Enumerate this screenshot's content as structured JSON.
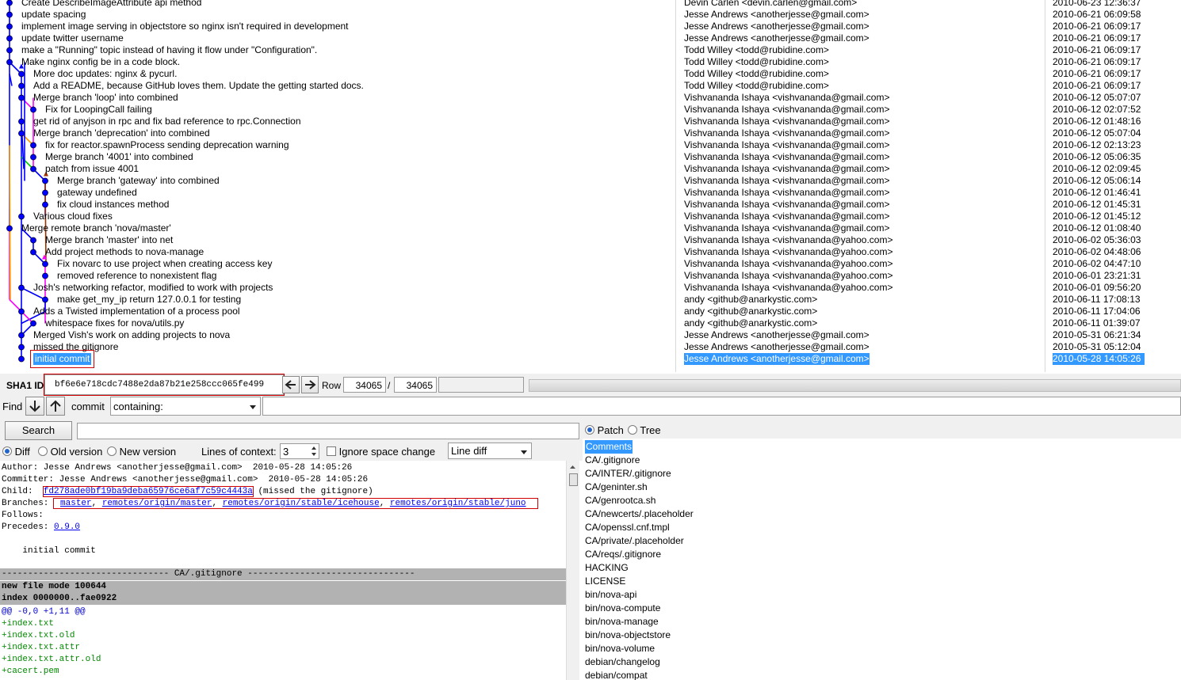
{
  "commits": [
    {
      "subject": "Create DescribeImageAttribute api method",
      "author": "Devin Carlen <devin.carlen@gmail.com>",
      "date": "2010-06-23 12:36:37"
    },
    {
      "subject": "update spacing",
      "author": "Jesse Andrews <anotherjesse@gmail.com>",
      "date": "2010-06-21 06:09:58"
    },
    {
      "subject": "implement image serving in objectstore so nginx isn't required in development",
      "author": "Jesse Andrews <anotherjesse@gmail.com>",
      "date": "2010-06-21 06:09:17"
    },
    {
      "subject": "update twitter username",
      "author": "Jesse Andrews <anotherjesse@gmail.com>",
      "date": "2010-06-21 06:09:17"
    },
    {
      "subject": "make a \"Running\" topic instead of having it flow under \"Configuration\".",
      "author": "Todd Willey <todd@rubidine.com>",
      "date": "2010-06-21 06:09:17"
    },
    {
      "subject": "Make nginx config be in a code block.",
      "author": "Todd Willey <todd@rubidine.com>",
      "date": "2010-06-21 06:09:17"
    },
    {
      "subject": "More doc updates: nginx & pycurl.",
      "author": "Todd Willey <todd@rubidine.com>",
      "date": "2010-06-21 06:09:17"
    },
    {
      "subject": "Add a README, because GitHub loves them.  Update the getting started docs.",
      "author": "Todd Willey <todd@rubidine.com>",
      "date": "2010-06-21 06:09:17"
    },
    {
      "subject": "Merge branch 'loop' into combined",
      "author": "Vishvananda Ishaya <vishvananda@gmail.com>",
      "date": "2010-06-12 05:07:07"
    },
    {
      "subject": "Fix for LoopingCall failing",
      "author": "Vishvananda Ishaya <vishvananda@gmail.com>",
      "date": "2010-06-12 02:07:52"
    },
    {
      "subject": "get rid of anyjson in rpc and fix bad reference to rpc.Connection",
      "author": "Vishvananda Ishaya <vishvananda@gmail.com>",
      "date": "2010-06-12 01:48:16"
    },
    {
      "subject": "Merge branch 'deprecation' into combined",
      "author": "Vishvananda Ishaya <vishvananda@gmail.com>",
      "date": "2010-06-12 05:07:04"
    },
    {
      "subject": "fix for reactor.spawnProcess sending deprecation warning",
      "author": "Vishvananda Ishaya <vishvananda@gmail.com>",
      "date": "2010-06-12 02:13:23"
    },
    {
      "subject": "Merge branch '4001' into combined",
      "author": "Vishvananda Ishaya <vishvananda@gmail.com>",
      "date": "2010-06-12 05:06:35"
    },
    {
      "subject": "patch from issue 4001",
      "author": "Vishvananda Ishaya <vishvananda@gmail.com>",
      "date": "2010-06-12 02:09:45"
    },
    {
      "subject": "Merge branch 'gateway' into combined",
      "author": "Vishvananda Ishaya <vishvananda@gmail.com>",
      "date": "2010-06-12 05:06:14"
    },
    {
      "subject": "gateway undefined",
      "author": "Vishvananda Ishaya <vishvananda@gmail.com>",
      "date": "2010-06-12 01:46:41"
    },
    {
      "subject": "fix cloud instances method",
      "author": "Vishvananda Ishaya <vishvananda@gmail.com>",
      "date": "2010-06-12 01:45:31"
    },
    {
      "subject": "Various cloud fixes",
      "author": "Vishvananda Ishaya <vishvananda@gmail.com>",
      "date": "2010-06-12 01:45:12"
    },
    {
      "subject": "Merge remote branch 'nova/master'",
      "author": "Vishvananda Ishaya <vishvananda@gmail.com>",
      "date": "2010-06-12 01:08:40"
    },
    {
      "subject": "Merge branch 'master' into net",
      "author": "Vishvananda Ishaya <vishvananda@yahoo.com>",
      "date": "2010-06-02 05:36:03"
    },
    {
      "subject": "Add project methods to nova-manage",
      "author": "Vishvananda Ishaya <vishvananda@yahoo.com>",
      "date": "2010-06-02 04:48:06"
    },
    {
      "subject": "Fix novarc to use project when creating access key",
      "author": "Vishvananda Ishaya <vishvananda@yahoo.com>",
      "date": "2010-06-02 04:47:10"
    },
    {
      "subject": "removed reference to nonexistent flag",
      "author": "Vishvananda Ishaya <vishvananda@yahoo.com>",
      "date": "2010-06-01 23:21:31"
    },
    {
      "subject": "Josh's networking refactor, modified to work with projects",
      "author": "Vishvananda Ishaya <vishvananda@yahoo.com>",
      "date": "2010-06-01 09:56:20"
    },
    {
      "subject": "make get_my_ip return 127.0.0.1 for testing",
      "author": "andy <github@anarkystic.com>",
      "date": "2010-06-11 17:08:13"
    },
    {
      "subject": "Adds a Twisted implementation of a process pool",
      "author": "andy <github@anarkystic.com>",
      "date": "2010-06-11 17:04:06"
    },
    {
      "subject": "whitespace fixes for nova/utils.py",
      "author": "andy <github@anarkystic.com>",
      "date": "2010-06-11 01:39:07"
    },
    {
      "subject": "Merged Vish's work on adding projects to nova",
      "author": "Jesse Andrews <anotherjesse@gmail.com>",
      "date": "2010-05-31 06:21:34"
    },
    {
      "subject": "missed the gitignore",
      "author": "Jesse Andrews <anotherjesse@gmail.com>",
      "date": "2010-05-31 05:12:04"
    },
    {
      "subject": "initial commit",
      "author": "Jesse Andrews <anotherjesse@gmail.com>",
      "date": "2010-05-28 14:05:26"
    }
  ],
  "graph_columns": [
    0,
    0,
    0,
    0,
    0,
    0,
    1,
    1,
    1,
    2,
    1,
    1,
    2,
    2,
    2,
    3,
    3,
    3,
    1,
    0,
    2,
    2,
    3,
    3,
    1,
    3,
    1,
    2,
    1,
    1,
    1
  ],
  "colors": {
    "blue": "#0000ff",
    "node": "#0000ff",
    "magenta": "#ff00ff",
    "orange": "#ff9900",
    "green": "#00cc00",
    "brown": "#993300",
    "selection": "#3399ff"
  },
  "sha": {
    "label": "SHA1 ID:",
    "value": "bf6e6e718cdc7488e2da87b21e258ccc065fe499",
    "row_label": "Row",
    "row_current": "34065",
    "row_sep": "/",
    "row_total": "34065"
  },
  "find": {
    "label": "Find",
    "commit_label": "commit",
    "mode": "containing:"
  },
  "search": {
    "button": "Search"
  },
  "options": {
    "diff": "Diff",
    "old": "Old version",
    "new": "New version",
    "context_label": "Lines of context:",
    "context_value": "3",
    "ignore": "Ignore space change",
    "line_diff": "Line diff"
  },
  "details": {
    "author": "Author: Jesse Andrews <anotherjesse@gmail.com>  2010-05-28 14:05:26",
    "committer": "Committer: Jesse Andrews <anotherjesse@gmail.com>  2010-05-28 14:05:26",
    "child_label": "Child:  ",
    "child_sha": "fd278ade0bf19ba9deba65976ce6af7c59c4443a",
    "child_msg": " (missed the gitignore)",
    "branches_label": "Branches: ",
    "branches": [
      "master",
      "remotes/origin/master",
      "remotes/origin/stable/icehouse",
      "remotes/origin/stable/juno"
    ],
    "follows": "Follows:",
    "precedes_label": "Precedes: ",
    "precedes_tag": "0.9.0",
    "message": "    initial commit"
  },
  "diff": {
    "file_header": "-------------------------------- CA/.gitignore --------------------------------",
    "meta": [
      "new file mode 100644",
      "index 0000000..fae0922"
    ],
    "hunk": "@@ -0,0 +1,11 @@",
    "added": [
      "+index.txt",
      "+index.txt.old",
      "+index.txt.attr",
      "+index.txt.attr.old",
      "+cacert.pem"
    ]
  },
  "view": {
    "patch": "Patch",
    "tree": "Tree"
  },
  "files": [
    "Comments",
    "CA/.gitignore",
    "CA/INTER/.gitignore",
    "CA/geninter.sh",
    "CA/genrootca.sh",
    "CA/newcerts/.placeholder",
    "CA/openssl.cnf.tmpl",
    "CA/private/.placeholder",
    "CA/reqs/.gitignore",
    "HACKING",
    "LICENSE",
    "bin/nova-api",
    "bin/nova-compute",
    "bin/nova-manage",
    "bin/nova-objectstore",
    "bin/nova-volume",
    "debian/changelog",
    "debian/compat"
  ]
}
